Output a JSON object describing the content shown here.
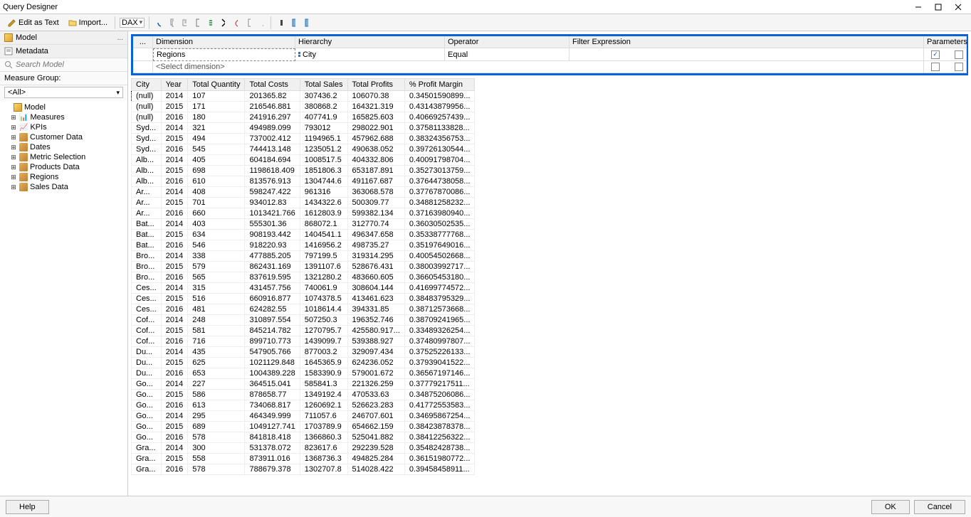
{
  "title": "Query Designer",
  "toolbar": {
    "edit_as_text": "Edit as Text",
    "import": "Import...",
    "lang": "DAX"
  },
  "left": {
    "model": "Model",
    "metadata": "Metadata",
    "search_placeholder": "Search Model",
    "measure_group": "Measure Group:",
    "mg_value": "<All>",
    "tree": [
      {
        "label": "Model",
        "type": "root"
      },
      {
        "label": "Measures",
        "type": "meas"
      },
      {
        "label": "KPIs",
        "type": "kpi"
      },
      {
        "label": "Customer Data",
        "type": "dim"
      },
      {
        "label": "Dates",
        "type": "dim"
      },
      {
        "label": "Metric Selection",
        "type": "dim"
      },
      {
        "label": "Products Data",
        "type": "dim"
      },
      {
        "label": "Regions",
        "type": "dim"
      },
      {
        "label": "Sales Data",
        "type": "dim"
      }
    ]
  },
  "filter": {
    "headers": {
      "dim": "Dimension",
      "hier": "Hierarchy",
      "op": "Operator",
      "expr": "Filter Expression",
      "params": "Parameters"
    },
    "row1": {
      "dim": "Regions",
      "hier": "City",
      "op": "Equal",
      "expr": "",
      "params_checked": true
    },
    "row2": {
      "dim": "<Select dimension>"
    }
  },
  "columns": [
    "City",
    "Year",
    "Total Quantity",
    "Total Costs",
    "Total Sales",
    "Total Profits",
    "% Profit Margin"
  ],
  "rows": [
    [
      "(null)",
      "2014",
      "107",
      "201365.82",
      "307436.2",
      "106070.38",
      "0.34501590899..."
    ],
    [
      "(null)",
      "2015",
      "171",
      "216546.881",
      "380868.2",
      "164321.319",
      "0.43143879956..."
    ],
    [
      "(null)",
      "2016",
      "180",
      "241916.297",
      "407741.9",
      "165825.603",
      "0.40669257439..."
    ],
    [
      "Syd...",
      "2014",
      "321",
      "494989.099",
      "793012",
      "298022.901",
      "0.37581133828..."
    ],
    [
      "Syd...",
      "2015",
      "494",
      "737002.412",
      "1194965.1",
      "457962.688",
      "0.38324356753..."
    ],
    [
      "Syd...",
      "2016",
      "545",
      "744413.148",
      "1235051.2",
      "490638.052",
      "0.39726130544..."
    ],
    [
      "Alb...",
      "2014",
      "405",
      "604184.694",
      "1008517.5",
      "404332.806",
      "0.40091798704..."
    ],
    [
      "Alb...",
      "2015",
      "698",
      "1198618.409",
      "1851806.3",
      "653187.891",
      "0.35273013759..."
    ],
    [
      "Alb...",
      "2016",
      "610",
      "813576.913",
      "1304744.6",
      "491167.687",
      "0.37644738058..."
    ],
    [
      "Ar...",
      "2014",
      "408",
      "598247.422",
      "961316",
      "363068.578",
      "0.37767870086..."
    ],
    [
      "Ar...",
      "2015",
      "701",
      "934012.83",
      "1434322.6",
      "500309.77",
      "0.34881258232..."
    ],
    [
      "Ar...",
      "2016",
      "660",
      "1013421.766",
      "1612803.9",
      "599382.134",
      "0.37163980940..."
    ],
    [
      "Bat...",
      "2014",
      "403",
      "555301.36",
      "868072.1",
      "312770.74",
      "0.36030502535..."
    ],
    [
      "Bat...",
      "2015",
      "634",
      "908193.442",
      "1404541.1",
      "496347.658",
      "0.35338777768..."
    ],
    [
      "Bat...",
      "2016",
      "546",
      "918220.93",
      "1416956.2",
      "498735.27",
      "0.35197649016..."
    ],
    [
      "Bro...",
      "2014",
      "338",
      "477885.205",
      "797199.5",
      "319314.295",
      "0.40054502668..."
    ],
    [
      "Bro...",
      "2015",
      "579",
      "862431.169",
      "1391107.6",
      "528676.431",
      "0.38003992717..."
    ],
    [
      "Bro...",
      "2016",
      "565",
      "837619.595",
      "1321280.2",
      "483660.605",
      "0.36605453180..."
    ],
    [
      "Ces...",
      "2014",
      "315",
      "431457.756",
      "740061.9",
      "308604.144",
      "0.41699774572..."
    ],
    [
      "Ces...",
      "2015",
      "516",
      "660916.877",
      "1074378.5",
      "413461.623",
      "0.38483795329..."
    ],
    [
      "Ces...",
      "2016",
      "481",
      "624282.55",
      "1018614.4",
      "394331.85",
      "0.38712573668..."
    ],
    [
      "Cof...",
      "2014",
      "248",
      "310897.554",
      "507250.3",
      "196352.746",
      "0.38709241965..."
    ],
    [
      "Cof...",
      "2015",
      "581",
      "845214.782",
      "1270795.7",
      "425580.917...",
      "0.33489326254..."
    ],
    [
      "Cof...",
      "2016",
      "716",
      "899710.773",
      "1439099.7",
      "539388.927",
      "0.37480997807..."
    ],
    [
      "Du...",
      "2014",
      "435",
      "547905.766",
      "877003.2",
      "329097.434",
      "0.37525226133..."
    ],
    [
      "Du...",
      "2015",
      "625",
      "1021129.848",
      "1645365.9",
      "624236.052",
      "0.37939041522..."
    ],
    [
      "Du...",
      "2016",
      "653",
      "1004389.228",
      "1583390.9",
      "579001.672",
      "0.36567197146..."
    ],
    [
      "Go...",
      "2014",
      "227",
      "364515.041",
      "585841.3",
      "221326.259",
      "0.37779217511..."
    ],
    [
      "Go...",
      "2015",
      "586",
      "878658.77",
      "1349192.4",
      "470533.63",
      "0.34875206086..."
    ],
    [
      "Go...",
      "2016",
      "613",
      "734068.817",
      "1260692.1",
      "526623.283",
      "0.41772553583..."
    ],
    [
      "Go...",
      "2014",
      "295",
      "464349.999",
      "711057.6",
      "246707.601",
      "0.34695867254..."
    ],
    [
      "Go...",
      "2015",
      "689",
      "1049127.741",
      "1703789.9",
      "654662.159",
      "0.38423878378..."
    ],
    [
      "Go...",
      "2016",
      "578",
      "841818.418",
      "1366860.3",
      "525041.882",
      "0.38412256322..."
    ],
    [
      "Gra...",
      "2014",
      "300",
      "531378.072",
      "823617.6",
      "292239.528",
      "0.35482428738..."
    ],
    [
      "Gra...",
      "2015",
      "558",
      "873911.016",
      "1368736.3",
      "494825.284",
      "0.36151980772..."
    ],
    [
      "Gra...",
      "2016",
      "578",
      "788679.378",
      "1302707.8",
      "514028.422",
      "0.39458458911..."
    ]
  ],
  "buttons": {
    "help": "Help",
    "ok": "OK",
    "cancel": "Cancel"
  }
}
